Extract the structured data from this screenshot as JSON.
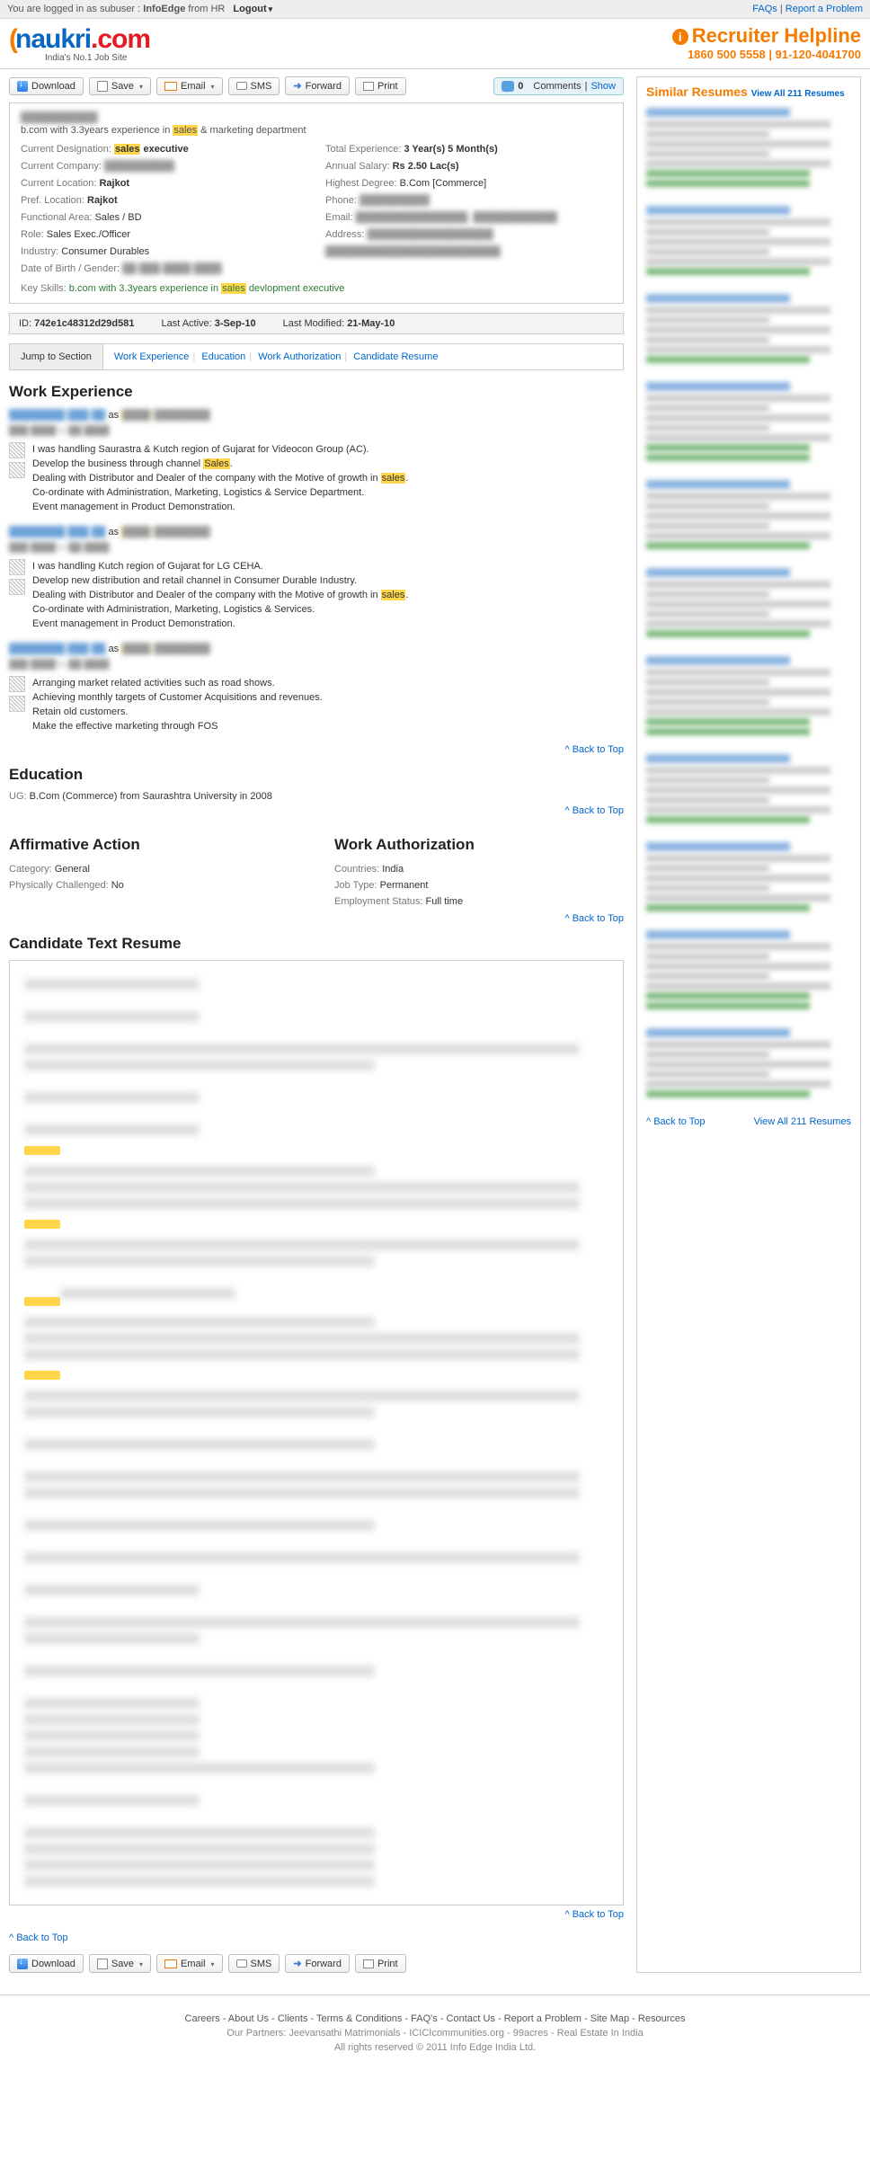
{
  "top": {
    "logged_in_prefix": "You are logged in as subuser :",
    "user": "InfoEdge",
    "from": "from HR",
    "logout": "Logout",
    "faqs": "FAQs",
    "report": "Report a Problem"
  },
  "brand": {
    "logo1": "naukri",
    "logo2": ".com",
    "tag": "India's No.1 Job Site",
    "helpline_label": "Recruiter Helpline",
    "helpline_num": "1860 500 5558 | 91-120-4041700"
  },
  "toolbar": {
    "download": "Download",
    "save": "Save",
    "email": "Email",
    "sms": "SMS",
    "forward": "Forward",
    "print": "Print",
    "comments_count": "0",
    "comments_label": "Comments",
    "show": "Show"
  },
  "profile": {
    "headline_pre": "b.com with 3.3years experience in ",
    "headline_hl": "sales",
    "headline_post": " & marketing department",
    "rows_left": [
      {
        "lab": "Current Designation:",
        "hl": "sales",
        "valpost": " executive"
      },
      {
        "lab": "Current Company:",
        "blur": "██████████"
      },
      {
        "lab": "Current Location:",
        "val": "Rajkot"
      },
      {
        "lab": "Pref. Location:",
        "val": "Rajkot"
      },
      {
        "lab": "Functional Area:",
        "valn": "Sales / BD"
      },
      {
        "lab": "Role:",
        "valn": "Sales Exec./Officer"
      },
      {
        "lab": "Industry:",
        "valn": "Consumer Durables"
      },
      {
        "lab": "Date of Birth / Gender:",
        "blur": "██ ███ ████ ████"
      }
    ],
    "rows_right": [
      {
        "lab": "Total Experience:",
        "val": "3 Year(s) 5 Month(s)"
      },
      {
        "lab": "Annual Salary:",
        "val": "Rs 2.50 Lac(s)"
      },
      {
        "lab": "Highest Degree:",
        "valn": "B.Com [Commerce]"
      },
      {
        "lab": "Phone:",
        "blur": "██████████"
      },
      {
        "lab": "Email:",
        "blur": "████████████████,\n████████████"
      },
      {
        "lab": "Address:",
        "blur": "██████████████████\n█████████████████████████"
      }
    ],
    "key_lab": "Key Skills:",
    "key_pre": " b.com with 3.3years experience in ",
    "key_hl": "sales",
    "key_post": " devlopment executive"
  },
  "idrow": {
    "id_lab": "ID:",
    "id": "742e1c48312d29d581",
    "la_lab": "Last Active:",
    "la": "3-Sep-10",
    "lm_lab": "Last Modified:",
    "lm": "21-May-10"
  },
  "jump": {
    "label": "Jump to Section",
    "l1": "Work Experience",
    "l2": "Education",
    "l3": "Work Authorization",
    "l4": "Candidate Resume"
  },
  "sect": {
    "work": "Work Experience",
    "edu": "Education",
    "aff": "Affirmative Action",
    "auth": "Work Authorization",
    "resume": "Candidate Text Resume",
    "backtop": "^ Back to Top"
  },
  "exp": [
    {
      "lines": [
        "I was handling Saurastra & Kutch region of Gujarat for Videocon Group (AC).",
        {
          "pre": "Develop the business through channel ",
          "hl": "Sales",
          "post": "."
        },
        {
          "pre": "Dealing with Distributor and Dealer of the company with the Motive of growth in ",
          "hl": "sales",
          "post": "."
        },
        "Co-ordinate with Administration, Marketing, Logistics & Service Department.",
        "Event management in Product Demonstration."
      ]
    },
    {
      "lines": [
        "I was handling Kutch region of Gujarat for LG CEHA.",
        "Develop new distribution and retail channel in Consumer Durable Industry.",
        {
          "pre": "Dealing with Distributor and Dealer of the company with the Motive of growth in ",
          "hl": "sales",
          "post": "."
        },
        "Co-ordinate with Administration, Marketing, Logistics & Services.",
        "Event management in Product Demonstration."
      ]
    },
    {
      "lines": [
        "Arranging market related activities such as road shows.",
        "Achieving monthly targets of Customer Acquisitions and revenues.",
        "Retain old customers.",
        "Make the effective marketing through FOS"
      ]
    }
  ],
  "edu": {
    "l1_lab": "UG:",
    "l1": "B.Com (Commerce) from Saurashtra University in 2008"
  },
  "aff": {
    "cat_lab": "Category:",
    "cat": "General",
    "phy_lab": "Physically Challenged:",
    "phy": "No"
  },
  "auth": {
    "c_lab": "Countries:",
    "c": "India",
    "j_lab": "Job Type:",
    "j": "Permanent",
    "e_lab": "Employment Status:",
    "e": "Full time"
  },
  "side": {
    "title": "Similar Resumes",
    "viewall": "View All 211 Resumes",
    "back": "^ Back to Top",
    "viewall2": "View All 211 Resumes"
  },
  "footer": {
    "links": "Careers - About Us - Clients - Terms & Conditions - FAQ's - Contact Us - Report a Problem - Site Map - Resources",
    "partners": "Our Partners: Jeevansathi Matrimonials - ICICIcommunities.org - 99acres - Real Estate In India",
    "copy": "All rights reserved © 2011 Info Edge India Ltd."
  }
}
